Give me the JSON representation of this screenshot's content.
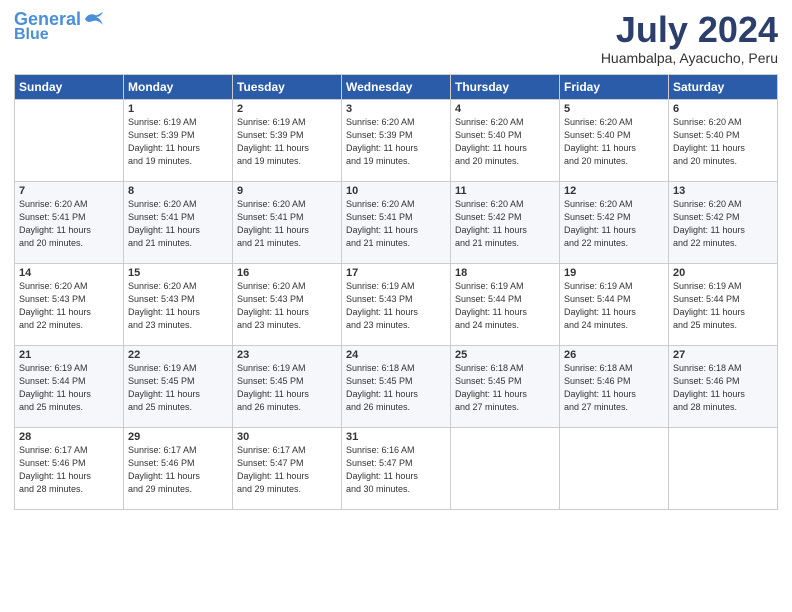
{
  "header": {
    "logo_line1": "General",
    "logo_line2": "Blue",
    "month_title": "July 2024",
    "location": "Huambalpa, Ayacucho, Peru"
  },
  "weekdays": [
    "Sunday",
    "Monday",
    "Tuesday",
    "Wednesday",
    "Thursday",
    "Friday",
    "Saturday"
  ],
  "weeks": [
    [
      {
        "day": "",
        "sunrise": "",
        "sunset": "",
        "daylight": ""
      },
      {
        "day": "1",
        "sunrise": "Sunrise: 6:19 AM",
        "sunset": "Sunset: 5:39 PM",
        "daylight": "Daylight: 11 hours and 19 minutes."
      },
      {
        "day": "2",
        "sunrise": "Sunrise: 6:19 AM",
        "sunset": "Sunset: 5:39 PM",
        "daylight": "Daylight: 11 hours and 19 minutes."
      },
      {
        "day": "3",
        "sunrise": "Sunrise: 6:20 AM",
        "sunset": "Sunset: 5:39 PM",
        "daylight": "Daylight: 11 hours and 19 minutes."
      },
      {
        "day": "4",
        "sunrise": "Sunrise: 6:20 AM",
        "sunset": "Sunset: 5:40 PM",
        "daylight": "Daylight: 11 hours and 20 minutes."
      },
      {
        "day": "5",
        "sunrise": "Sunrise: 6:20 AM",
        "sunset": "Sunset: 5:40 PM",
        "daylight": "Daylight: 11 hours and 20 minutes."
      },
      {
        "day": "6",
        "sunrise": "Sunrise: 6:20 AM",
        "sunset": "Sunset: 5:40 PM",
        "daylight": "Daylight: 11 hours and 20 minutes."
      }
    ],
    [
      {
        "day": "7",
        "sunrise": "Sunrise: 6:20 AM",
        "sunset": "Sunset: 5:41 PM",
        "daylight": "Daylight: 11 hours and 20 minutes."
      },
      {
        "day": "8",
        "sunrise": "Sunrise: 6:20 AM",
        "sunset": "Sunset: 5:41 PM",
        "daylight": "Daylight: 11 hours and 21 minutes."
      },
      {
        "day": "9",
        "sunrise": "Sunrise: 6:20 AM",
        "sunset": "Sunset: 5:41 PM",
        "daylight": "Daylight: 11 hours and 21 minutes."
      },
      {
        "day": "10",
        "sunrise": "Sunrise: 6:20 AM",
        "sunset": "Sunset: 5:41 PM",
        "daylight": "Daylight: 11 hours and 21 minutes."
      },
      {
        "day": "11",
        "sunrise": "Sunrise: 6:20 AM",
        "sunset": "Sunset: 5:42 PM",
        "daylight": "Daylight: 11 hours and 21 minutes."
      },
      {
        "day": "12",
        "sunrise": "Sunrise: 6:20 AM",
        "sunset": "Sunset: 5:42 PM",
        "daylight": "Daylight: 11 hours and 22 minutes."
      },
      {
        "day": "13",
        "sunrise": "Sunrise: 6:20 AM",
        "sunset": "Sunset: 5:42 PM",
        "daylight": "Daylight: 11 hours and 22 minutes."
      }
    ],
    [
      {
        "day": "14",
        "sunrise": "Sunrise: 6:20 AM",
        "sunset": "Sunset: 5:43 PM",
        "daylight": "Daylight: 11 hours and 22 minutes."
      },
      {
        "day": "15",
        "sunrise": "Sunrise: 6:20 AM",
        "sunset": "Sunset: 5:43 PM",
        "daylight": "Daylight: 11 hours and 23 minutes."
      },
      {
        "day": "16",
        "sunrise": "Sunrise: 6:20 AM",
        "sunset": "Sunset: 5:43 PM",
        "daylight": "Daylight: 11 hours and 23 minutes."
      },
      {
        "day": "17",
        "sunrise": "Sunrise: 6:19 AM",
        "sunset": "Sunset: 5:43 PM",
        "daylight": "Daylight: 11 hours and 23 minutes."
      },
      {
        "day": "18",
        "sunrise": "Sunrise: 6:19 AM",
        "sunset": "Sunset: 5:44 PM",
        "daylight": "Daylight: 11 hours and 24 minutes."
      },
      {
        "day": "19",
        "sunrise": "Sunrise: 6:19 AM",
        "sunset": "Sunset: 5:44 PM",
        "daylight": "Daylight: 11 hours and 24 minutes."
      },
      {
        "day": "20",
        "sunrise": "Sunrise: 6:19 AM",
        "sunset": "Sunset: 5:44 PM",
        "daylight": "Daylight: 11 hours and 25 minutes."
      }
    ],
    [
      {
        "day": "21",
        "sunrise": "Sunrise: 6:19 AM",
        "sunset": "Sunset: 5:44 PM",
        "daylight": "Daylight: 11 hours and 25 minutes."
      },
      {
        "day": "22",
        "sunrise": "Sunrise: 6:19 AM",
        "sunset": "Sunset: 5:45 PM",
        "daylight": "Daylight: 11 hours and 25 minutes."
      },
      {
        "day": "23",
        "sunrise": "Sunrise: 6:19 AM",
        "sunset": "Sunset: 5:45 PM",
        "daylight": "Daylight: 11 hours and 26 minutes."
      },
      {
        "day": "24",
        "sunrise": "Sunrise: 6:18 AM",
        "sunset": "Sunset: 5:45 PM",
        "daylight": "Daylight: 11 hours and 26 minutes."
      },
      {
        "day": "25",
        "sunrise": "Sunrise: 6:18 AM",
        "sunset": "Sunset: 5:45 PM",
        "daylight": "Daylight: 11 hours and 27 minutes."
      },
      {
        "day": "26",
        "sunrise": "Sunrise: 6:18 AM",
        "sunset": "Sunset: 5:46 PM",
        "daylight": "Daylight: 11 hours and 27 minutes."
      },
      {
        "day": "27",
        "sunrise": "Sunrise: 6:18 AM",
        "sunset": "Sunset: 5:46 PM",
        "daylight": "Daylight: 11 hours and 28 minutes."
      }
    ],
    [
      {
        "day": "28",
        "sunrise": "Sunrise: 6:17 AM",
        "sunset": "Sunset: 5:46 PM",
        "daylight": "Daylight: 11 hours and 28 minutes."
      },
      {
        "day": "29",
        "sunrise": "Sunrise: 6:17 AM",
        "sunset": "Sunset: 5:46 PM",
        "daylight": "Daylight: 11 hours and 29 minutes."
      },
      {
        "day": "30",
        "sunrise": "Sunrise: 6:17 AM",
        "sunset": "Sunset: 5:47 PM",
        "daylight": "Daylight: 11 hours and 29 minutes."
      },
      {
        "day": "31",
        "sunrise": "Sunrise: 6:16 AM",
        "sunset": "Sunset: 5:47 PM",
        "daylight": "Daylight: 11 hours and 30 minutes."
      },
      {
        "day": "",
        "sunrise": "",
        "sunset": "",
        "daylight": ""
      },
      {
        "day": "",
        "sunrise": "",
        "sunset": "",
        "daylight": ""
      },
      {
        "day": "",
        "sunrise": "",
        "sunset": "",
        "daylight": ""
      }
    ]
  ]
}
